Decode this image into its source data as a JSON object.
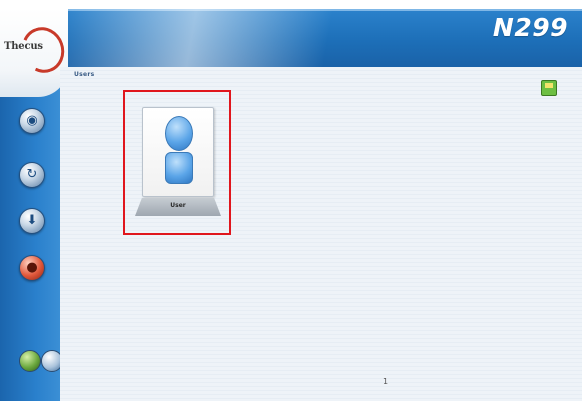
{
  "header": {
    "logo_text": "Thecus",
    "model": "N299"
  },
  "sidebar": {
    "items": [
      {
        "icon": "status-icon"
      },
      {
        "icon": "network-icon"
      },
      {
        "icon": "storage-icon"
      },
      {
        "icon": "user-icon"
      }
    ],
    "bottom_icons": [
      "language-icon",
      "logout-icon"
    ]
  },
  "main": {
    "breadcrumb": "Users",
    "tiles": [
      {
        "label": "User",
        "selected": true
      }
    ],
    "page_number": "1"
  },
  "colors": {
    "banner": "#1d6fb8",
    "highlight": "#e0161d",
    "panel": "#eef3f8"
  }
}
